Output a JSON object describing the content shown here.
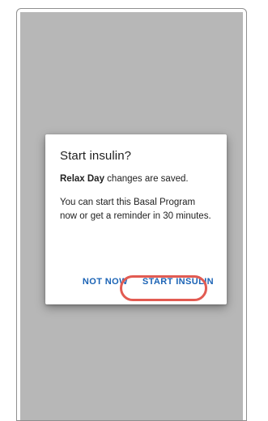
{
  "dialog": {
    "title": "Start insulin?",
    "saved_program": "Relax Day",
    "saved_suffix": " changes are saved.",
    "body": "You can start this Basal Program now or get a reminder in 30 minutes.",
    "not_now_label": "NOT NOW",
    "start_label": "START INSULIN"
  },
  "colors": {
    "scrim": "#b7b7b7",
    "button_text": "#1b63b5",
    "highlight": "#e25b52"
  }
}
